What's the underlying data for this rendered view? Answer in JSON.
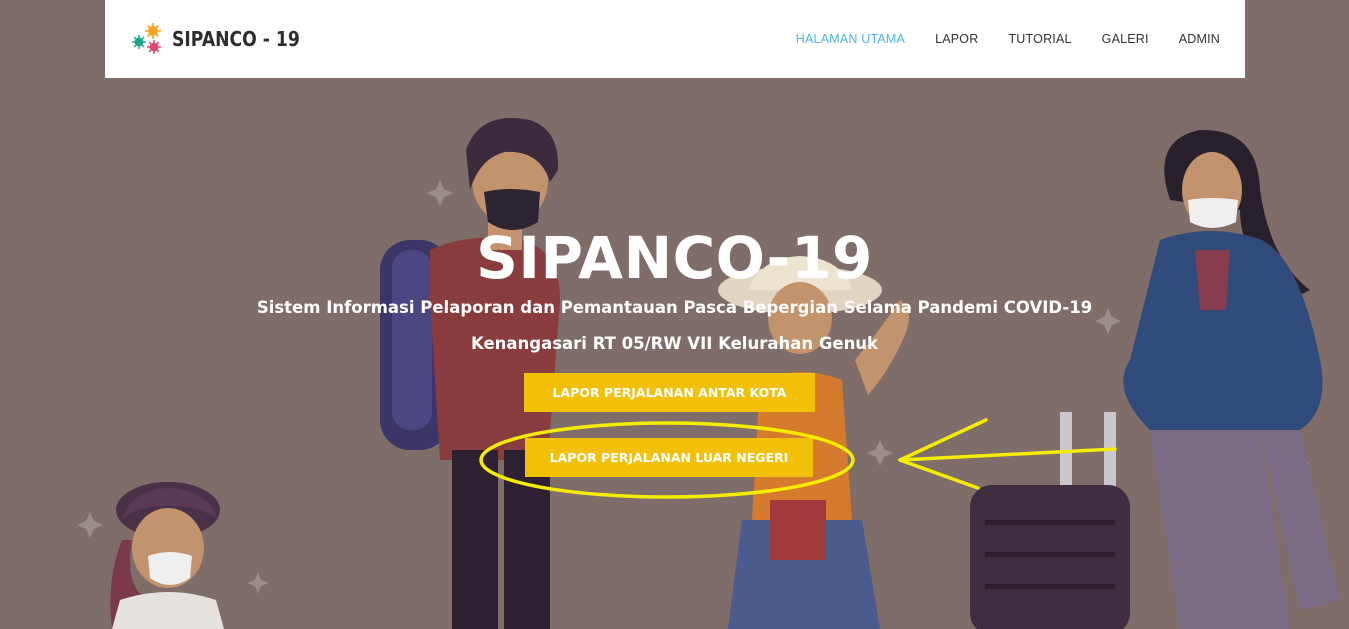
{
  "navbar": {
    "brand": "SIPANCO - 19",
    "links": [
      {
        "label": "HALAMAN UTAMA",
        "active": true
      },
      {
        "label": "LAPOR"
      },
      {
        "label": "TUTORIAL"
      },
      {
        "label": "GALERI"
      },
      {
        "label": "ADMIN"
      }
    ]
  },
  "hero": {
    "title": "SIPANCO-19",
    "subtitle": "Sistem Informasi Pelaporan dan Pemantauan Pasca Bepergian Selama Pandemi COVID-19",
    "location": "Kenangasari RT 05/RW VII Kelurahan Genuk",
    "buttons": {
      "antar_kota": "LAPOR PERJALANAN ANTAR KOTA",
      "luar_negeri": "LAPOR PERJALANAN LUAR NEGERI"
    }
  },
  "colors": {
    "background": "#7e6d69",
    "accent_button": "#f2c107",
    "nav_active": "#4fb5e6",
    "annotation": "#f5ec00"
  },
  "icons": [
    "virus-logo-icon"
  ]
}
